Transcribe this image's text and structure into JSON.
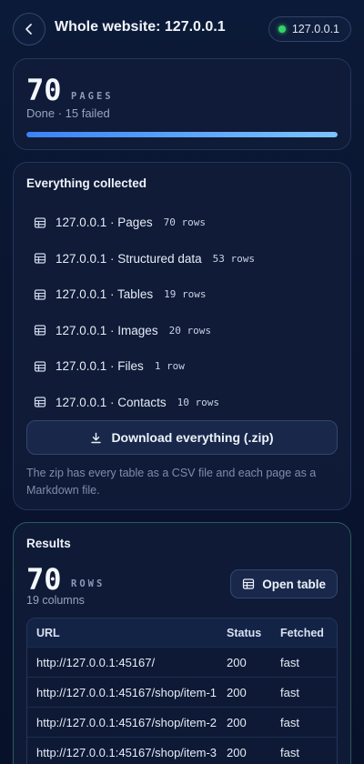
{
  "header": {
    "title": "Whole website: 127.0.0.1",
    "host_pill": "127.0.0.1",
    "status_color": "#34d36a"
  },
  "pages_card": {
    "count": "70",
    "unit": "PAGES",
    "status": "Done · 15 failed",
    "progress_fraction": 1.0
  },
  "collected": {
    "heading": "Everything collected",
    "tables": [
      {
        "name": "127.0.0.1 · Pages",
        "rows": "70 rows"
      },
      {
        "name": "127.0.0.1 · Structured data",
        "rows": "53 rows"
      },
      {
        "name": "127.0.0.1 · Tables",
        "rows": "19 rows"
      },
      {
        "name": "127.0.0.1 · Images",
        "rows": "20 rows"
      },
      {
        "name": "127.0.0.1 · Files",
        "rows": "1 row"
      },
      {
        "name": "127.0.0.1 · Contacts",
        "rows": "10 rows"
      }
    ],
    "download_label": "Download everything (.zip)",
    "note": "The zip has every table as a CSV file and each page as a Markdown file."
  },
  "results": {
    "heading": "Results",
    "count": "70",
    "unit": "ROWS",
    "columns_text": "19 columns",
    "open_table_label": "Open table",
    "table": {
      "headers": [
        "URL",
        "Status",
        "Fetched"
      ],
      "rows": [
        [
          "http://127.0.0.1:45167/",
          "200",
          "fast"
        ],
        [
          "http://127.0.0.1:45167/shop/item-1",
          "200",
          "fast"
        ],
        [
          "http://127.0.0.1:45167/shop/item-2",
          "200",
          "fast"
        ],
        [
          "http://127.0.0.1:45167/shop/item-3",
          "200",
          "fast"
        ]
      ]
    }
  },
  "icons": {
    "back": "chevron-left-icon",
    "table": "table-icon",
    "download": "download-icon"
  }
}
